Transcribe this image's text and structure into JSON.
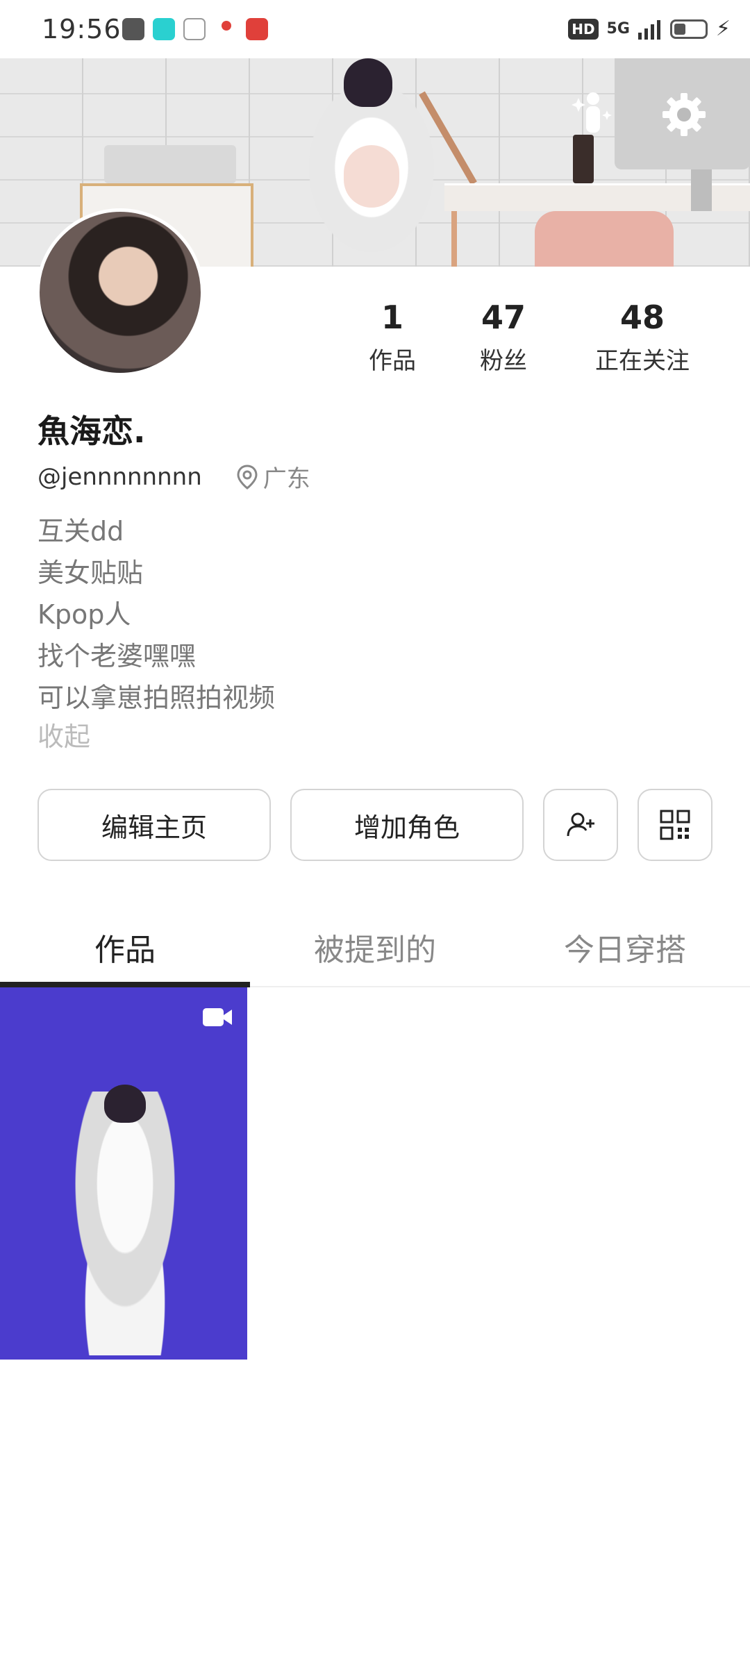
{
  "status_bar": {
    "time": "19:56",
    "hd": "HD",
    "signal": "5G"
  },
  "profile": {
    "name": "魚海恋.",
    "handle": "@jennnnnnnn",
    "location": "广东",
    "bio": [
      "互关dd",
      "美女贴贴",
      "Kpop人",
      "找个老婆嘿嘿",
      "可以拿崽拍照拍视频"
    ],
    "collapse_label": "收起"
  },
  "stats": [
    {
      "value": "1",
      "label": "作品"
    },
    {
      "value": "47",
      "label": "粉丝"
    },
    {
      "value": "48",
      "label": "正在关注"
    }
  ],
  "buttons": {
    "edit": "编辑主页",
    "add_role": "增加角色"
  },
  "tabs": [
    {
      "label": "作品",
      "active": true
    },
    {
      "label": "被提到的",
      "active": false
    },
    {
      "label": "今日穿搭",
      "active": false
    }
  ],
  "posts": [
    {
      "type": "video",
      "background": "#4b3ccd"
    }
  ],
  "icons": [
    "gear-icon",
    "avatar-figure-icon",
    "location-pin-icon",
    "add-friend-icon",
    "qr-code-icon",
    "video-camera-icon"
  ]
}
